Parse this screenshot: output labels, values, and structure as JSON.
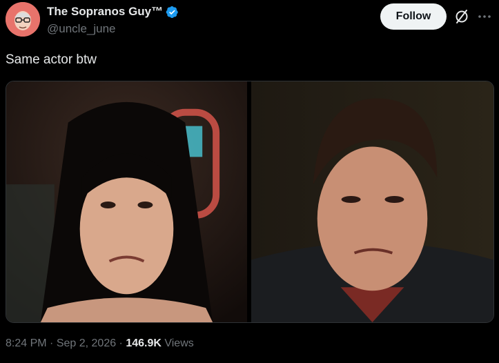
{
  "author": {
    "display_name": "The Sopranos Guy™",
    "handle": "@uncle_june",
    "avatar_icon": "avatar-bald-man-glasses",
    "verified_icon": "verified-badge-icon"
  },
  "actions": {
    "follow_label": "Follow",
    "grok_icon": "grok-icon",
    "more_icon": "more-icon"
  },
  "tweet": {
    "text": "Same actor btw"
  },
  "media": [
    {
      "name": "photo-woman-pouting"
    },
    {
      "name": "photo-man-pouting"
    }
  ],
  "meta": {
    "time": "8:24 PM",
    "separator1": " · ",
    "date": "Sep 2, 2026",
    "separator2": " · ",
    "views_count": "146.9K",
    "views_label": " Views"
  },
  "colors": {
    "background": "#000000",
    "text_primary": "#e7e9ea",
    "text_secondary": "#71767b",
    "verified": "#1d9bf0",
    "follow_bg": "#eff3f4"
  }
}
